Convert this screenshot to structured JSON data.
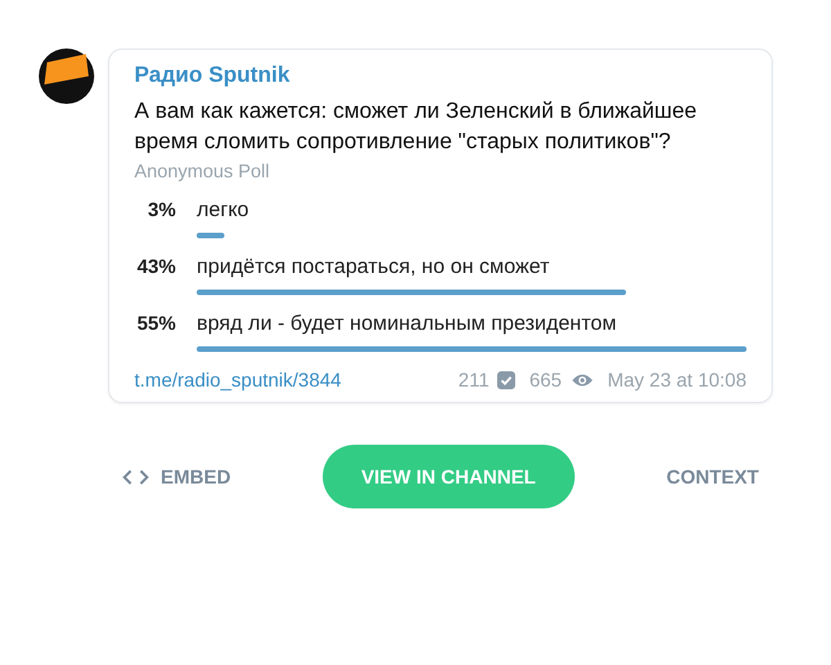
{
  "channel": {
    "name": "Радио Sputnik"
  },
  "poll": {
    "question": "А вам как кажется: сможет ли Зеленский в ближайшее время сломить сопротивление \"старых политиков\"?",
    "type": "Anonymous Poll",
    "options": [
      {
        "percent": "3%",
        "text": "легко"
      },
      {
        "percent": "43%",
        "text": "придётся постараться, но он сможет"
      },
      {
        "percent": "55%",
        "text": "вряд ли - будет номинальным президентом"
      }
    ]
  },
  "footer": {
    "link": "t.me/radio_sputnik/3844",
    "votes": "211",
    "views": "665",
    "date": "May 23 at 10:08"
  },
  "actions": {
    "embed": "EMBED",
    "view": "VIEW IN CHANNEL",
    "context": "CONTEXT"
  }
}
